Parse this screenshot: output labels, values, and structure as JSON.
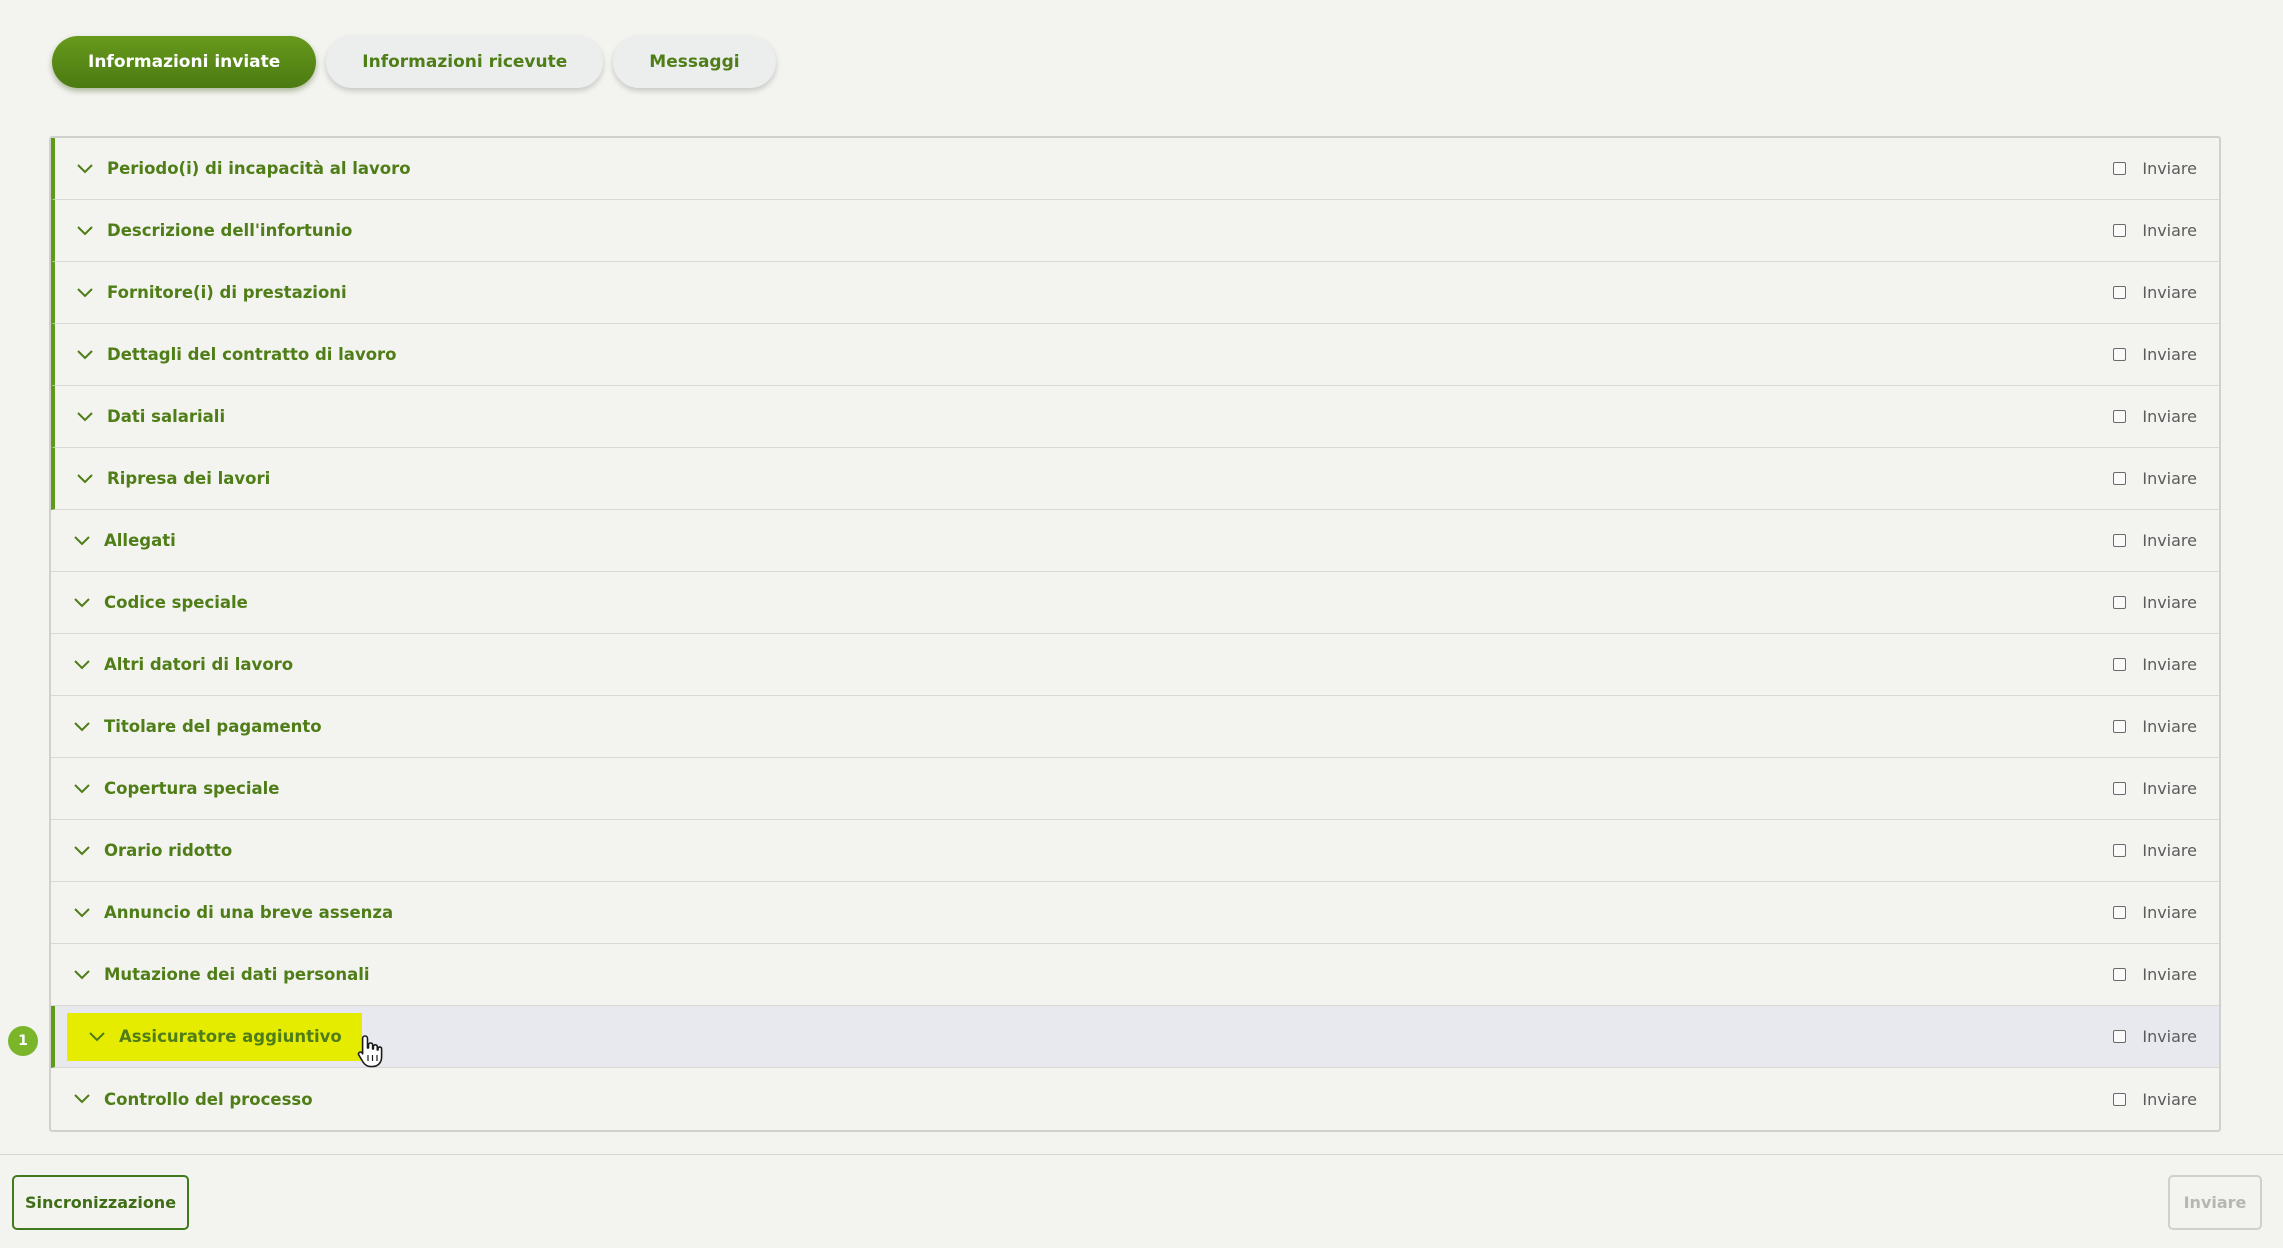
{
  "tabs": [
    {
      "label": "Informazioni inviate",
      "active": true
    },
    {
      "label": "Informazioni ricevute",
      "active": false
    },
    {
      "label": "Messaggi",
      "active": false
    }
  ],
  "sections": [
    {
      "title": "Periodo(i) di incapacità al lavoro",
      "send_label": "Inviare"
    },
    {
      "title": "Descrizione dell'infortunio",
      "send_label": "Inviare"
    },
    {
      "title": "Fornitore(i) di prestazioni",
      "send_label": "Inviare"
    },
    {
      "title": "Dettagli del contratto di lavoro",
      "send_label": "Inviare"
    },
    {
      "title": "Dati salariali",
      "send_label": "Inviare"
    },
    {
      "title": "Ripresa dei lavori",
      "send_label": "Inviare"
    },
    {
      "title": "Allegati",
      "send_label": "Inviare"
    },
    {
      "title": "Codice speciale",
      "send_label": "Inviare"
    },
    {
      "title": "Altri datori di lavoro",
      "send_label": "Inviare"
    },
    {
      "title": "Titolare del pagamento",
      "send_label": "Inviare"
    },
    {
      "title": "Copertura speciale",
      "send_label": "Inviare"
    },
    {
      "title": "Orario ridotto",
      "send_label": "Inviare"
    },
    {
      "title": "Annuncio di una breve assenza",
      "send_label": "Inviare"
    },
    {
      "title": "Mutazione dei dati personali",
      "send_label": "Inviare"
    },
    {
      "title": "Assicuratore aggiuntivo",
      "send_label": "Inviare"
    },
    {
      "title": "Controllo del processo",
      "send_label": "Inviare"
    }
  ],
  "step_badge": "1",
  "footer": {
    "sync_label": "Sincronizzazione",
    "send_label": "Inviare"
  },
  "colors": {
    "accent": "#4f7d17",
    "highlight": "#e6ec00",
    "badge": "#7bb52a"
  }
}
